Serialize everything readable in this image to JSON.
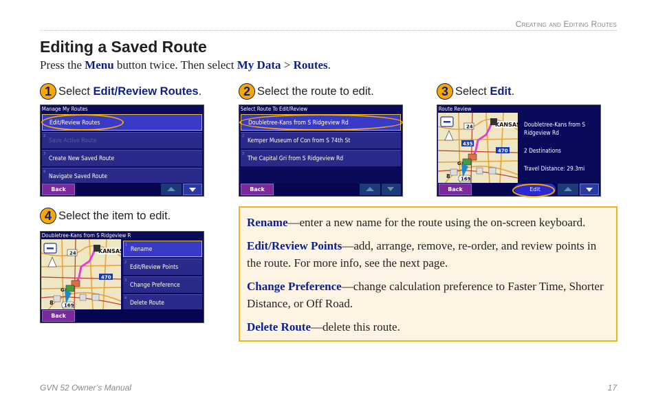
{
  "running_head": "Creating and Editing Routes",
  "page_title": "Editing a Saved Route",
  "intro": {
    "prefix": "Press the ",
    "menu": "Menu",
    "middle": " button twice. Then select ",
    "mydata": "My Data",
    "sep": " > ",
    "routes": "Routes",
    "suffix": "."
  },
  "steps": [
    {
      "number": "1",
      "prefix": "Select ",
      "keyword": "Edit/Review Routes",
      "suffix": "."
    },
    {
      "number": "2",
      "text": "Select the route to edit."
    },
    {
      "number": "3",
      "prefix": "Select ",
      "keyword": "Edit",
      "suffix": "."
    },
    {
      "number": "4",
      "text": "Select the item to edit."
    }
  ],
  "screen1": {
    "title": "Manage My Routes",
    "items": [
      {
        "idx": "1",
        "label": "Edit/Review Routes"
      },
      {
        "idx": "2",
        "label": "Save Active Route"
      },
      {
        "idx": "3",
        "label": "Create New Saved Route"
      },
      {
        "idx": "4",
        "label": "Navigate Saved Route"
      }
    ],
    "back": "Back"
  },
  "screen2": {
    "title": "Select Route To Edit/Review",
    "items": [
      {
        "idx": "1",
        "label": "Doubletree-Kans from S Ridgeview Rd"
      },
      {
        "idx": "2",
        "label": "Kemper Museum of Con from S 74th St"
      },
      {
        "idx": "3",
        "label": "The Capital Gri from S Ridgeview Rd"
      }
    ],
    "back": "Back"
  },
  "screen3": {
    "title": "Route Review",
    "route_name": "Doubletree-Kans from S Ridgeview Rd",
    "destinations": "2 Destinations",
    "distance": "Travel Distance: 29.3mi",
    "back": "Back",
    "edit": "Edit",
    "map_labels": {
      "hwy24": "24",
      "i435": "435",
      "i470": "470",
      "us169": "169",
      "rt8": "8",
      "city": "KANSAS",
      "town": "Ga"
    }
  },
  "screen4": {
    "title": "Doubletree-Kans from S Ridgeview R",
    "items": [
      {
        "idx": "1",
        "label": "Rename"
      },
      {
        "idx": "2",
        "label": "Edit/Review Points"
      },
      {
        "idx": "3",
        "label": "Change Preference"
      },
      {
        "idx": "4",
        "label": "Delete Route"
      }
    ],
    "back": "Back"
  },
  "descriptions": [
    {
      "term": "Rename",
      "text": "—enter a new name for the route using the on-screen keyboard."
    },
    {
      "term": "Edit/Review Points",
      "text": "—add, arrange, remove, re-order, and review points in the route. For more info, see the next page."
    },
    {
      "term": "Change Preference",
      "text": "—change calculation preference to Faster Time, Shorter Distance, or Off Road."
    },
    {
      "term": "Delete Route",
      "text": "—delete this route."
    }
  ],
  "footer": {
    "manual": "GVN 52 Owner’s Manual",
    "page": "17"
  },
  "colors": {
    "accent_blue": "#0b1f8c",
    "step_badge": "#f7a900",
    "box_bg": "#fdf4e3",
    "box_border": "#f2b21c"
  }
}
